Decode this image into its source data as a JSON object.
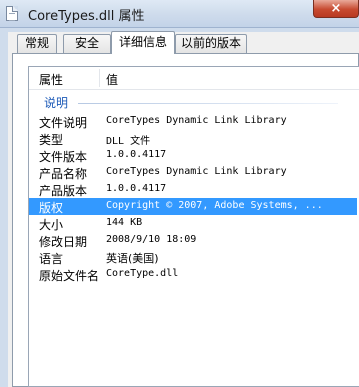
{
  "window": {
    "title": "CoreTypes.dll 属性",
    "close_glyph": "×"
  },
  "tabs": [
    {
      "label": "常规",
      "active": false
    },
    {
      "label": "安全",
      "active": false
    },
    {
      "label": "详细信息",
      "active": true
    },
    {
      "label": "以前的版本",
      "active": false
    }
  ],
  "details": {
    "columns": {
      "property": "属性",
      "value": "值"
    },
    "group": "说明",
    "rows": [
      {
        "key": "文件说明",
        "value": "CoreTypes Dynamic Link Library",
        "selected": false
      },
      {
        "key": "类型",
        "value": "DLL 文件",
        "selected": false
      },
      {
        "key": "文件版本",
        "value": "1.0.0.4117",
        "selected": false
      },
      {
        "key": "产品名称",
        "value": "CoreTypes Dynamic Link Library",
        "selected": false
      },
      {
        "key": "产品版本",
        "value": "1.0.0.4117",
        "selected": false
      },
      {
        "key": "版权",
        "value": "Copyright © 2007, Adobe Systems, ...",
        "selected": true
      },
      {
        "key": "大小",
        "value": "144 KB",
        "selected": false
      },
      {
        "key": "修改日期",
        "value": "2008/9/10 18:09",
        "selected": false
      },
      {
        "key": "语言",
        "value": "英语(美国)",
        "selected": false
      },
      {
        "key": "原始文件名",
        "value": "CoreType.dll",
        "selected": false
      }
    ]
  },
  "colors": {
    "selection": "#3399ff",
    "group_label": "#1e5bb8",
    "close_button": "#c74a30"
  }
}
